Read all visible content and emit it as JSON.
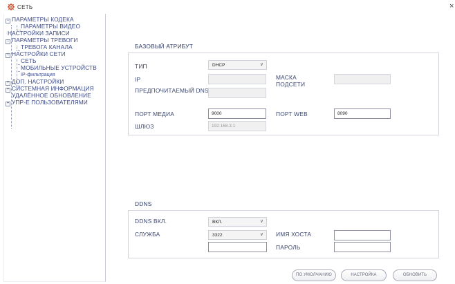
{
  "window": {
    "title": "СЕТЬ",
    "close_glyph": "×",
    "icon": "gear-wrench-icon"
  },
  "sidebar": {
    "items": [
      {
        "label": "ПАРАМЕТРЫ КОДЕКА",
        "toggle": "−"
      },
      {
        "label": "ПАРАМЕТРЫ ВИДЕО"
      },
      {
        "label": "НАСТРОЙКИ ЗАПИСИ"
      },
      {
        "label": "ПАРАМЕТРЫ ТРЕВОГИ",
        "toggle": "−"
      },
      {
        "label": "ТРЕВОГА КАНАЛА"
      },
      {
        "label": "НАСТРОЙКИ СЕТИ",
        "toggle": "−"
      },
      {
        "label": "СЕТЬ"
      },
      {
        "label": "МОБИЛЬНЫЕ УСТРОЙСТВ"
      },
      {
        "label": "IP-фильтрация"
      },
      {
        "label": "ДОП. НАСТРОЙКИ",
        "toggle": "+"
      },
      {
        "label": "СИСТЕМНАЯ ИНФОРМАЦИЯ",
        "toggle": "+"
      },
      {
        "label": "УДАЛЁННОЕ ОБНОВЛЕНИЕ"
      },
      {
        "label": "УПР-Е ПОЛЬЗОВАТЕЛЯМИ",
        "toggle": "+"
      }
    ]
  },
  "basic": {
    "section_title": "БАЗОВЫЙ АТРИБУТ",
    "type_label": "ТИП",
    "type_value": "DHCP",
    "ip_label": "IP",
    "ip_value": "",
    "mask_label": "МАСКА ПОДСЕТИ",
    "mask_value": "",
    "dns_label": "ПРЕДПОЧИТАЕМЫЙ DNS",
    "dns_value": "",
    "media_port_label": "ПОРТ МЕДИА",
    "media_port_value": "9000",
    "web_port_label": "ПОРТ WEB",
    "web_port_value": "8090",
    "gateway_label": "ШЛЮЗ",
    "gateway_value": "192.168.3.1"
  },
  "ddns": {
    "section_title": "DDNS",
    "enabled_label": "DDNS ВКЛ.",
    "enabled_value": "ВКЛ.",
    "service_label": "СЛУЖБА",
    "service_value": "3322",
    "host_label": "ИМЯ ХОСТА",
    "host_value": "",
    "password_label": "ПАРОЛЬ",
    "password_value": "",
    "extra_value": ""
  },
  "buttons": {
    "default_label": "ПО УМОЛЧАНИЮ",
    "settings_label": "НАСТРОЙКА",
    "refresh_label": "ОБНОВИТЬ"
  },
  "colors": {
    "link_text": "#3c4a8a",
    "label_text": "#3c4870",
    "border": "#d2d4dc"
  }
}
